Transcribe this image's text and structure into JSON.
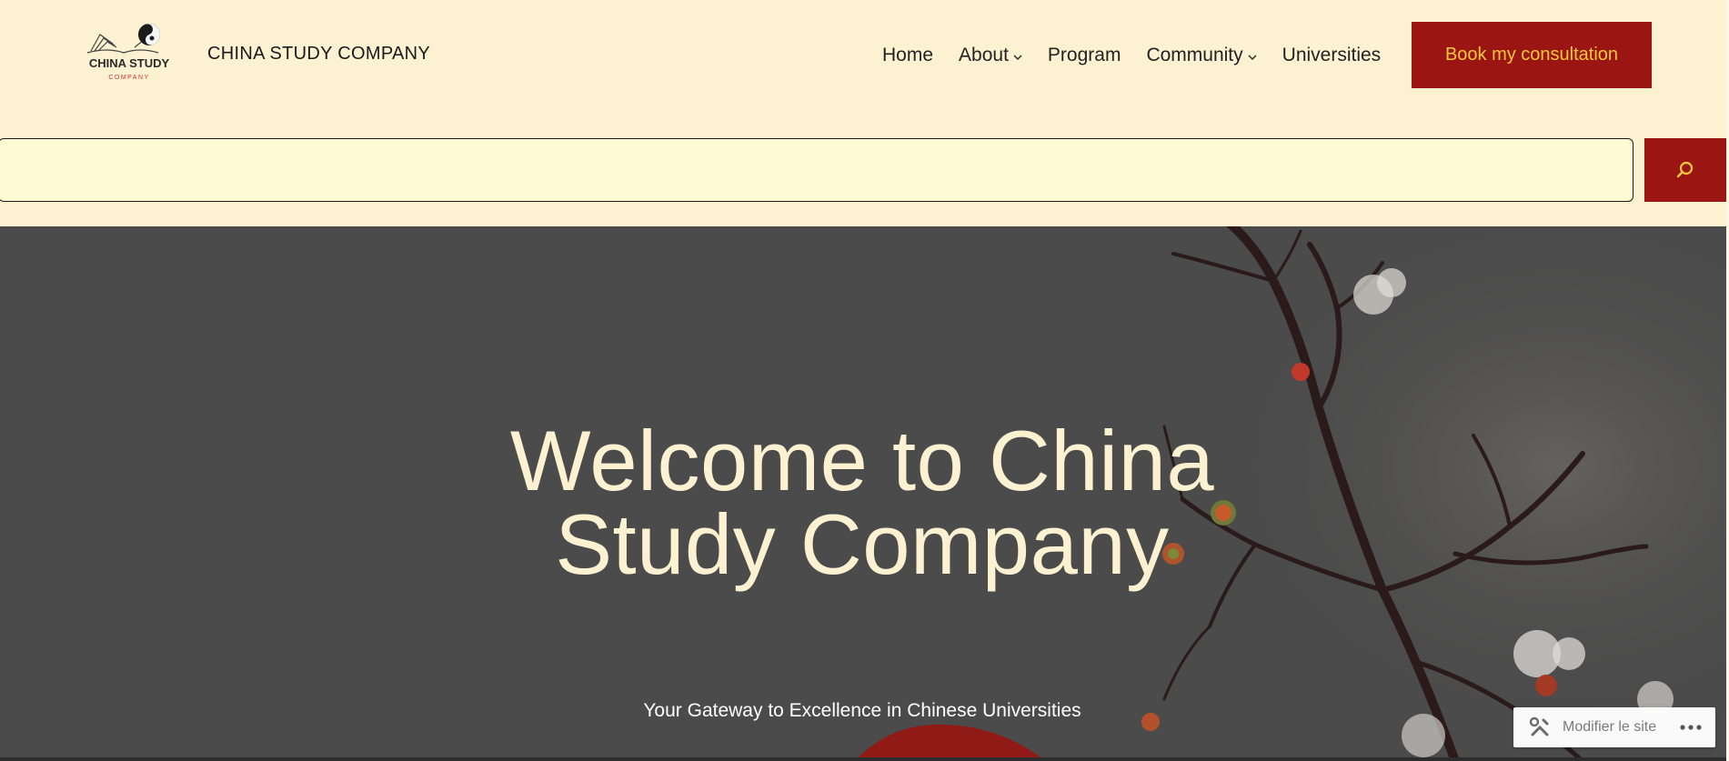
{
  "header": {
    "site_title": "CHINA STUDY COMPANY",
    "logo": {
      "icon": "book-yin-yang-logo",
      "line1": "CHINA STUDY",
      "line2": "COMPANY"
    }
  },
  "nav": {
    "items": [
      {
        "label": "Home",
        "has_dropdown": false
      },
      {
        "label": "About",
        "has_dropdown": true
      },
      {
        "label": "Program",
        "has_dropdown": false
      },
      {
        "label": "Community",
        "has_dropdown": true
      },
      {
        "label": "Universities",
        "has_dropdown": false
      }
    ],
    "cta_label": "Book my consultation"
  },
  "search": {
    "value": "",
    "placeholder": "",
    "button_icon": "search-icon"
  },
  "hero": {
    "title": "Welcome to China Study Company",
    "subtitle": "Your Gateway to Excellence in Chinese Universities"
  },
  "admin_bar": {
    "edit_label": "Modifier le site",
    "edit_icon": "tools-icon",
    "more_icon": "more-horizontal-icon"
  },
  "colors": {
    "page_bg": "#fcf1d1",
    "search_bg": "#fefbd4",
    "accent_red": "#9b1512",
    "accent_gold": "#f6c83b",
    "hero_overlay": "#4b4b4b",
    "hero_text": "#fcf1d1"
  }
}
